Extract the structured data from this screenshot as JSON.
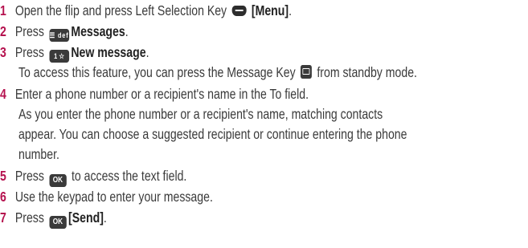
{
  "steps": [
    {
      "num": "1",
      "pre": "Open the flip and press Left Selection Key ",
      "key_icon": "left-soft-key-icon",
      "bold": "[Menu]",
      "post": "."
    },
    {
      "num": "2",
      "pre": "Press ",
      "key_label": "☰ def",
      "bold": "Messages",
      "post": "."
    },
    {
      "num": "3",
      "pre": "Press ",
      "key_label": "1 ☆",
      "bold": "New message",
      "post": ".",
      "note_pre": "To access this feature, you can press the Message Key ",
      "note_icon": "message-key-icon",
      "note_post": " from standby mode."
    },
    {
      "num": "4",
      "text": "Enter a phone number or a recipient's name in the To field.",
      "lines": [
        "As you enter the phone number or a recipient's name, matching contacts",
        "appear. You can choose a suggested recipient or continue entering the phone",
        "number."
      ]
    },
    {
      "num": "5",
      "pre": "Press ",
      "key_label": "OK",
      "post": " to access the text field."
    },
    {
      "num": "6",
      "text": "Use the keypad to enter your message."
    },
    {
      "num": "7",
      "pre": "Press ",
      "key_label": "OK",
      "bold": "[Send]",
      "post": "."
    }
  ]
}
